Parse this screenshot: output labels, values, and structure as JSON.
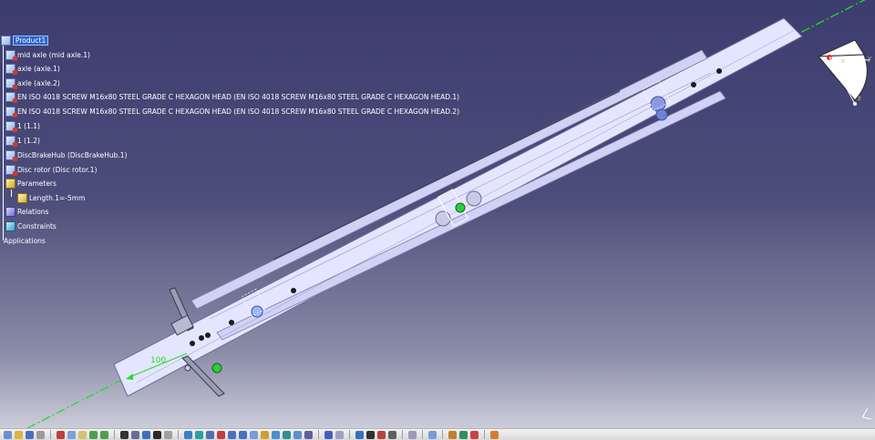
{
  "tree": {
    "root": "Product1",
    "items": [
      {
        "label": "mid axle (mid axle.1)",
        "icon": "part-icon"
      },
      {
        "label": "axle (axle.1)",
        "icon": "part-icon"
      },
      {
        "label": "axle (axle.2)",
        "icon": "part-icon"
      },
      {
        "label": "EN ISO 4018 SCREW M16x80 STEEL GRADE C HEXAGON HEAD (EN ISO 4018 SCREW M16x80 STEEL GRADE C HEXAGON HEAD.1)",
        "icon": "part-icon"
      },
      {
        "label": "EN ISO 4018 SCREW M16x80 STEEL GRADE C HEXAGON HEAD (EN ISO 4018 SCREW M16x80 STEEL GRADE C HEXAGON HEAD.2)",
        "icon": "part-icon"
      },
      {
        "label": "1 (1.1)",
        "icon": "part-icon"
      },
      {
        "label": "1 (1.2)",
        "icon": "part-icon"
      },
      {
        "label": "DiscBrakeHub (DiscBrakeHub.1)",
        "icon": "part-icon"
      },
      {
        "label": "Disc rotor (Disc rotor.1)",
        "icon": "part-icon"
      },
      {
        "label": "Parameters",
        "icon": "parameters-icon"
      },
      {
        "label": "Length.1=-5mm",
        "icon": "length-parameter-icon"
      },
      {
        "label": "Relations",
        "icon": "relations-icon"
      },
      {
        "label": "Constraints",
        "icon": "constraints-icon"
      },
      {
        "label": "Applications",
        "icon": "applications-icon"
      }
    ]
  },
  "viewport": {
    "dimension_text": "100",
    "axis_labels": {
      "x": "x",
      "y": "y",
      "z": "z"
    }
  },
  "colors": {
    "background_top": "#3c3d6f",
    "part_fill": "#e4e6ff",
    "centerline": "#22dd22",
    "selection": "#2d63c9"
  }
}
